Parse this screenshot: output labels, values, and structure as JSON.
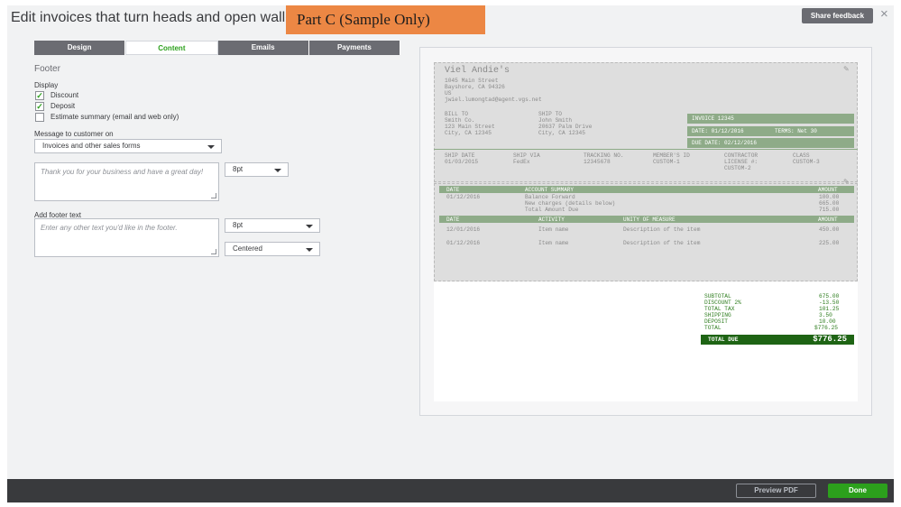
{
  "header": {
    "title": "Edit invoices that turn heads and open walle",
    "overlay": "Part C (Sample Only)",
    "share_feedback": "Share feedback",
    "close": "×"
  },
  "tabs": [
    "Design",
    "Content",
    "Emails",
    "Payments"
  ],
  "active_tab": "Content",
  "footer_section": {
    "title": "Footer",
    "display_label": "Display",
    "checkboxes": [
      {
        "label": "Discount",
        "checked": true
      },
      {
        "label": "Deposit",
        "checked": true
      },
      {
        "label": "Estimate summary (email and web only)",
        "checked": false
      }
    ],
    "message_label": "Message to customer on",
    "message_select": "Invoices and other sales forms",
    "message_text": "Thank you for your business and have a great day!",
    "message_font_size": "8pt",
    "add_footer_label": "Add footer text",
    "footer_placeholder": "Enter any other text you'd like in the footer.",
    "footer_font_size": "8pt",
    "footer_align": "Centered"
  },
  "invoice": {
    "company": "Viel Andie's",
    "address": [
      "1045 Main Street",
      "Bayshore, CA 94326",
      "US",
      "jwiel.lumongtad@agent.vgs.net"
    ],
    "bill_to_label": "BILL TO",
    "bill_to": [
      "Smith Co.",
      "123 Main Street",
      "City, CA 12345"
    ],
    "ship_to_label": "SHIP TO",
    "ship_to": [
      "John Smith",
      "20637 Palm Drive",
      "City, CA 12345"
    ],
    "invoice_no": "INVOICE 12345",
    "date_line": "DATE: 01/12/2016",
    "terms": "TERMS: Net 30",
    "due_date": "DUE DATE: 02/12/2016",
    "ship_headers": [
      "SHIP DATE",
      "SHIP VIA",
      "TRACKING NO.",
      "MEMBER'S ID",
      "CONTRACTOR",
      "CLASS"
    ],
    "ship_values": [
      "01/03/2015",
      "FedEx",
      "12345678",
      "CUSTOM-1",
      "LICENSE #:",
      "CUSTOM-3"
    ],
    "ship_extra": "CUSTOM-2",
    "account_headers": [
      "DATE",
      "ACCOUNT SUMMARY",
      "AMOUNT"
    ],
    "account_date": "01/12/2016",
    "account_rows": [
      {
        "label": "Balance Forward",
        "amount": "100.00"
      },
      {
        "label": "New charges (details below)",
        "amount": "665.00"
      },
      {
        "label": "Total Amount Due",
        "amount": "715.00"
      }
    ],
    "item_headers": [
      "DATE",
      "ACTIVITY",
      "UNITY OF MEASURE",
      "AMOUNT"
    ],
    "items": [
      {
        "date": "12/01/2016",
        "activity": "Item name",
        "desc": "Description of the item",
        "amount": "450.00"
      },
      {
        "date": "01/12/2016",
        "activity": "Item name",
        "desc": "Description of the item",
        "amount": "225.00"
      }
    ],
    "totals": [
      {
        "label": "SUBTOTAL",
        "value": "675.00"
      },
      {
        "label": "DISCOUNT 2%",
        "value": "-13.50"
      },
      {
        "label": "TOTAL TAX",
        "value": "101.25"
      },
      {
        "label": "SHIPPING",
        "value": "3.50"
      },
      {
        "label": "DEPOSIT",
        "value": "10.00"
      },
      {
        "label": "TOTAL",
        "value": "$776.25"
      }
    ],
    "total_due_label": "TOTAL DUE",
    "total_due_value": "$776.25"
  },
  "bottom_bar": {
    "preview_pdf": "Preview PDF",
    "done": "Done"
  },
  "colors": {
    "accent_green": "#2ca01c",
    "tab_dark": "#6b6c72",
    "overlay_orange": "#ec8744",
    "invoice_green": "#8eab88",
    "total_due_green": "#1e6414"
  }
}
